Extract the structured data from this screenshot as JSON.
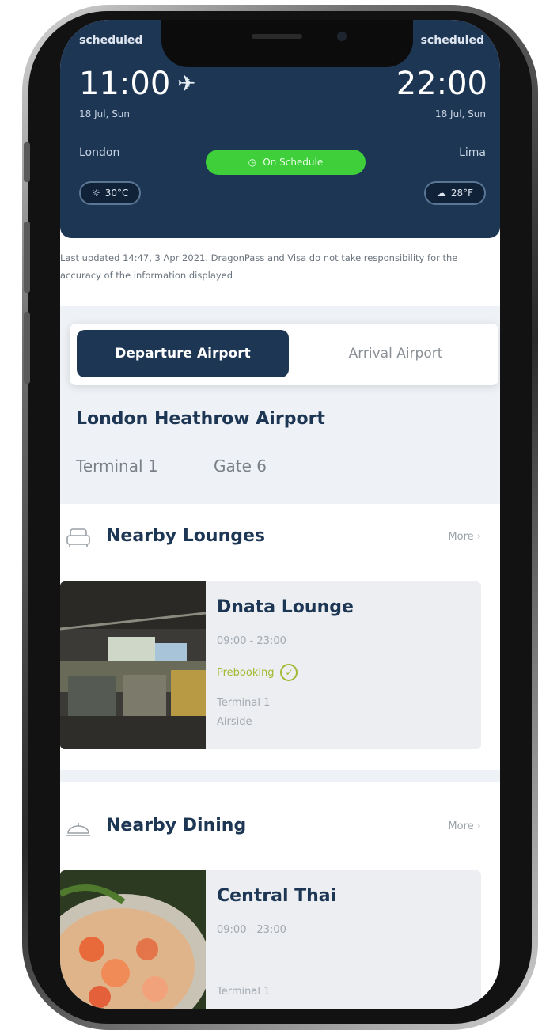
{
  "flight": {
    "departure_status": "scheduled",
    "arrival_status": "scheduled",
    "departure_time": "11:00",
    "arrival_time": "22:00",
    "departure_date": "18 Jul, Sun",
    "arrival_date": "18 Jul, Sun",
    "departure_city": "London",
    "arrival_city": "Lima",
    "status_pill": "On Schedule",
    "departure_temp": "30°C",
    "arrival_temp": "28°F"
  },
  "updated_note": "Last updated 14:47, 3 Apr 2021. DragonPass and Visa do not take responsibility for the accuracy of the information displayed",
  "airport_tabs": {
    "departure": "Departure Airport",
    "arrival": "Arrival Airport"
  },
  "airport": {
    "name": "London Heathrow Airport",
    "terminal": "Terminal 1",
    "gate": "Gate 6"
  },
  "lounges": {
    "title": "Nearby Lounges",
    "more": "More",
    "card": {
      "name": "Dnata Lounge",
      "hours": "09:00 - 23:00",
      "prebooking": "Prebooking",
      "terminal": "Terminal 1",
      "zone": "Airside"
    }
  },
  "dining": {
    "title": "Nearby Dining",
    "more": "More",
    "card": {
      "name": "Central Thai",
      "hours": "09:00 - 23:00",
      "terminal": "Terminal 1"
    }
  },
  "colors": {
    "navy": "#1c3654",
    "green": "#3ecf3a",
    "accent_olive": "#a3b832"
  }
}
